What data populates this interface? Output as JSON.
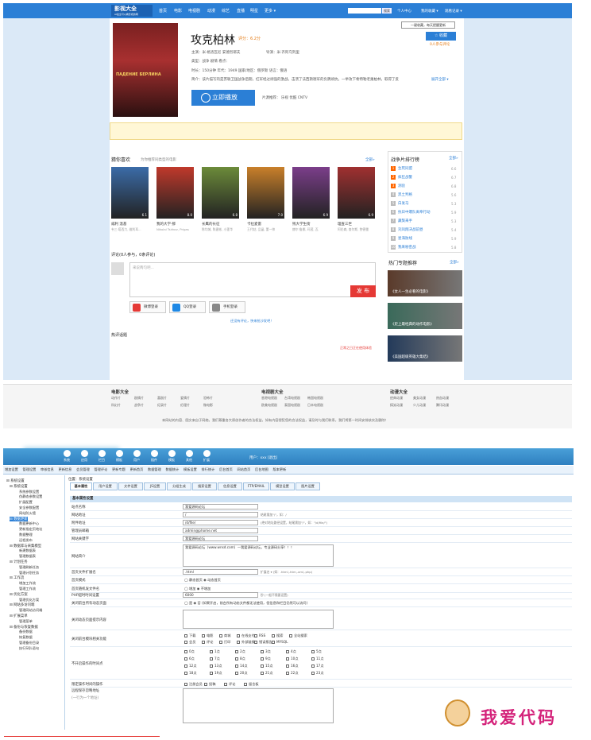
{
  "site": {
    "logo": "影视大全",
    "logo_sub": "AI最全可以看影视的网",
    "nav": [
      "首页",
      "电影",
      "电视剧",
      "动漫",
      "综艺",
      "直播",
      "明星",
      "更多 ▾"
    ],
    "search_btn": "搜索",
    "center": "个人中心",
    "records": "我的收藏 ▾",
    "history": "观看记录 ▾"
  },
  "movie": {
    "poster_text": "ПАДЕНИЕ БЕРЛИНА",
    "title": "攻克柏林",
    "score": "评分：6.2分",
    "fav_tip": "一键收藏，每天提醒更新",
    "fav_btn": "☆ 收藏",
    "fav_count": "0人参与评论",
    "cast": "主演：米·格洛瓦尼 安德烈耶夫",
    "director": "导演：米·齐阿乌列里",
    "type": "类型：战争  剧情          看点：",
    "info": "时长：150分钟     年代：1949     国家/地区：俄罗斯     语言：俄语",
    "synopsis": "简介：该片描写的是苏联卫国战争后期，红军经过顽强的激战，击溃了法西斯德军的负隅顽抗，一举攻下希特勒老巢柏林，取得了反",
    "expand": "展开全部 ▾",
    "play": "立即播放",
    "sources": "片源推荐：  乐视    优酷    CNTV"
  },
  "recommend": {
    "title": "猜你喜欢",
    "sub": "为你推荐同类型的电影",
    "more": "全部»",
    "items": [
      {
        "name": "威利 温基",
        "cast": "韦三·塔西力, 维利耳..."
      },
      {
        "name": "我的大学·那",
        "cast": "Nikolai Tsirkov, Prigas"
      },
      {
        "name": "长鹰的长征",
        "cast": "陈均城, 陈建彬, 小蓬华"
      },
      {
        "name": "卡拉麦雷",
        "cast": "王代姑, 品晶, 董一帅"
      },
      {
        "name": "残大学生街",
        "cast": "赫尔·鲁娜, 玛茜, 瓦"
      },
      {
        "name": "理查三世",
        "cast": "阿伦森, 查尔斯, 詹德雷"
      }
    ],
    "scores": [
      "6.1",
      "8.0",
      "6.8",
      "7.0",
      "6.9",
      "6.9"
    ]
  },
  "ranking": {
    "title": "战争片排行榜",
    "more": "全部»",
    "items": [
      {
        "n": "1",
        "t": "生死同盟",
        "s": "6.6"
      },
      {
        "n": "2",
        "t": "疯狂战警",
        "s": "6.7"
      },
      {
        "n": "3",
        "t": "测验",
        "s": "6.8"
      },
      {
        "n": "4",
        "t": "黑土判格",
        "s": "5.6"
      },
      {
        "n": "5",
        "t": "白发马",
        "s": "5.3"
      },
      {
        "n": "6",
        "t": "抗日中爆队离奉行动",
        "s": "5.9"
      },
      {
        "n": "7",
        "t": "藏獒来手",
        "s": "5.3"
      },
      {
        "n": "8",
        "t": "刘凤翔决战前昼",
        "s": "5.4"
      },
      {
        "n": "9",
        "t": "星海防线",
        "s": "5.9"
      },
      {
        "n": "10",
        "t": "我来秘密战",
        "s": "5.8"
      }
    ]
  },
  "topics": {
    "title": "热门专题推荐",
    "more": "全部»",
    "items": [
      "《女人一生必看的电影》",
      "《史上最经典的动作电影》",
      "《美国超级英雄大集结》"
    ]
  },
  "comment": {
    "title": "评论(0人参与，0条评论)",
    "placeholder": "来说两句吧...",
    "post": "发 布",
    "logins": [
      "微博登录",
      "QQ登录",
      "手机登录"
    ],
    "count_text": "还没有评论，快来抢沙发吧！",
    "hot": "热评话题",
    "report": "正常之日正在使用体验"
  },
  "footer": {
    "groups": [
      {
        "title": "电影大全",
        "links": [
          "动作片",
          "剧情片",
          "喜剧片",
          "爱情片",
          "恐怖片",
          "科幻片",
          "战争片",
          "纪录片",
          "伦理片",
          "微电影"
        ]
      },
      {
        "title": "电视剧大全",
        "links": [
          "香港电视剧",
          "台湾电视剧",
          "韩国电视剧",
          "欧美电视剧",
          "泰国电视剧",
          "日本电视剧"
        ]
      },
      {
        "title": "动漫大全",
        "links": [
          "经典动漫",
          "美女动漫",
          "热血动漫",
          "搞笑动漫",
          "少儿动漫",
          "腾讯动漫"
        ]
      }
    ],
    "copyright": "本网站的内容、图文来自于网络，我们尊重各大原创作者的合法权益，如有内容侵犯您的合法权益，请及时与我们联系，我们将第一时间安排核实及删除！"
  },
  "admin": {
    "icons": [
      "系统",
      "应用",
      "栏目",
      "模板",
      "用户",
      "插件",
      "模板",
      "其他",
      "扩展"
    ],
    "user": "用户：xxx  [退出]",
    "submenu": [
      "增加设置",
      "管理设置",
      "审核信息",
      "更新信息",
      "会员管理",
      "管理评论",
      "更新专题",
      "更新首页",
      "数据管理",
      "数据统计",
      "模板设置",
      "排行统计",
      "后台首页",
      "网站首页",
      "后台地图",
      "版本更新"
    ],
    "sidebar": [
      {
        "lv": 1,
        "t": "⊟ 系统设置"
      },
      {
        "lv": 2,
        "t": "⊟ 系统设置"
      },
      {
        "lv": 3,
        "t": "系统参数设置"
      },
      {
        "lv": 3,
        "t": "伪静态参数设置"
      },
      {
        "lv": 3,
        "t": "扩展配置"
      },
      {
        "lv": 3,
        "t": "安全参数配置"
      },
      {
        "lv": 3,
        "t": "网站防火墙"
      },
      {
        "lv": 2,
        "t": "⊟ 数据更新"
      },
      {
        "lv": 3,
        "t": "数据更新中心"
      },
      {
        "lv": 3,
        "t": "更新指定页地址"
      },
      {
        "lv": 3,
        "t": "数据整理"
      },
      {
        "lv": 3,
        "t": "远程发布"
      },
      {
        "lv": 2,
        "t": "⊟ 数据库与采集模型"
      },
      {
        "lv": 3,
        "t": "新建数据表"
      },
      {
        "lv": 3,
        "t": "管理数据表"
      },
      {
        "lv": 2,
        "t": "⊟ 计划任务"
      },
      {
        "lv": 3,
        "t": "管理刷新任务"
      },
      {
        "lv": 3,
        "t": "管理计划任务"
      },
      {
        "lv": 2,
        "t": "⊟ 工作流"
      },
      {
        "lv": 3,
        "t": "增加工作流"
      },
      {
        "lv": 3,
        "t": "管理工作流"
      },
      {
        "lv": 2,
        "t": "⊟ 优化方案"
      },
      {
        "lv": 3,
        "t": "管理优化方案"
      },
      {
        "lv": 2,
        "t": "⊟ 网站多访问端"
      },
      {
        "lv": 3,
        "t": "管理网站访问端"
      },
      {
        "lv": 2,
        "t": "⊟ 扩展菜单"
      },
      {
        "lv": 3,
        "t": "管理菜单"
      },
      {
        "lv": 2,
        "t": "⊟ 备份与恢复数据"
      },
      {
        "lv": 3,
        "t": "备份数据"
      },
      {
        "lv": 3,
        "t": "恢复数据"
      },
      {
        "lv": 3,
        "t": "管理备份目录"
      },
      {
        "lv": 3,
        "t": "执行SQL语句"
      }
    ],
    "crumb": "位置：系统设置",
    "tabs": [
      "基本属性",
      "用户设置",
      "文件设置",
      "JS设置",
      "分组生成",
      "搜索设置",
      "信息设置",
      "FTP/EMAIL",
      "模型设置",
      "图片设置"
    ],
    "form_title": "基本属性设置",
    "rows": [
      {
        "l": "站点名称",
        "v": "我爱源码论坛",
        "h": ""
      },
      {
        "l": "网站地址",
        "v": "/",
        "h": "结尾需加\"/\"，如：/"
      },
      {
        "l": "附件地址",
        "v": "/d/file/",
        "h": "(绝对地址路径设置，结尾需加\"/\"，如：\"/d/file/\")"
      },
      {
        "l": "管理员邮箱",
        "v": "admin@phome.net",
        "h": ""
      },
      {
        "l": "网站关键字",
        "v": "我爱源码论坛",
        "h": ""
      }
    ],
    "intro_label": "网站简介",
    "intro": "我爱源码论坛（www.wnsd.com）—我爱源码论坛，专业源码分享！！！",
    "rows2": [
      {
        "l": "首页文件扩展名",
        "v": ".html",
        "h": "扩展名 ▾   (如：.html,.htm,.xml,.php)"
      },
      {
        "l": "首页模式",
        "v": "",
        "h": "◯ 静态首页  ◉ 动态首页"
      },
      {
        "l": "首页随机发文件名",
        "v": "",
        "h": "◯ 增加  ◉ 不增加"
      },
      {
        "l": "PHP超时时间设置",
        "v": "6000",
        "h": "秒 (一般不需要设置)"
      },
      {
        "l": "关闭前台所有动态页面",
        "v": "",
        "h": "◯ 是  ◉ 否 (如果开启，前台所有动态文件都无法使用，但信息和栏目仍然可以访问)"
      }
    ],
    "close_dyn": "关闭动态页面提示内容",
    "close_mod": "关闭前台模块相关功能",
    "mods": [
      "下载",
      "电影",
      "商城",
      "在线支付",
      "RSS",
      "搜索",
      "全站搜索",
      "会员",
      "评论",
      "打印",
      "外部链接",
      "错误报告",
      "MYSQL"
    ],
    "no_gen": "不开启操作的时间点",
    "hours": [
      "0点",
      "1点",
      "2点",
      "3点",
      "4点",
      "5点",
      "6点",
      "7点",
      "8点",
      "9点",
      "10点",
      "11点",
      "12点",
      "13点",
      "14点",
      "15点",
      "16点",
      "17点",
      "18点",
      "19点",
      "20点",
      "21点",
      "22点",
      "23点"
    ],
    "limit_ops": "限定操作时间的操作",
    "ops": [
      "注册会员",
      "投稿",
      "评论",
      "留言板"
    ],
    "remote": "远程保存忽略地址",
    "remote_sub": "(一行为一个地址)"
  },
  "brand": "我爱代码"
}
